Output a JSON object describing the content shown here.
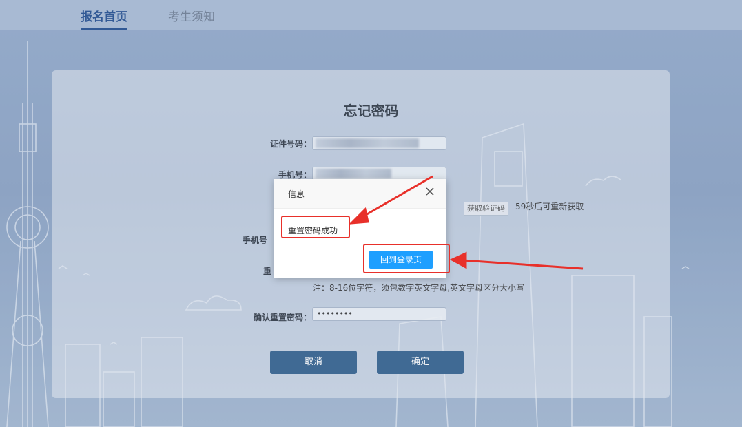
{
  "nav": {
    "tabs": [
      {
        "label": "报名首页",
        "active": true
      },
      {
        "label": "考生须知",
        "active": false
      }
    ]
  },
  "form": {
    "title": "忘记密码",
    "id_label": "证件号码：",
    "phone_label": "手机号：",
    "code_label_partial": "手机号",
    "reset_label_partial": "重",
    "get_code_button": "获取验证码",
    "countdown": "59秒后可重新获取",
    "password_hint": "注：8-16位字符，须包数字英文字母,英文字母区分大小写",
    "confirm_label": "确认重置密码：",
    "confirm_value": "••••••••",
    "cancel_button": "取消",
    "ok_button": "确定"
  },
  "dialog": {
    "title": "信息",
    "message": "重置密码成功",
    "button": "回到登录页"
  },
  "colors": {
    "nav_active": "#1e4a8e",
    "primary_button": "#2f5f8c",
    "dialog_button": "#1e9fff",
    "annotation_red": "#e8302a"
  }
}
